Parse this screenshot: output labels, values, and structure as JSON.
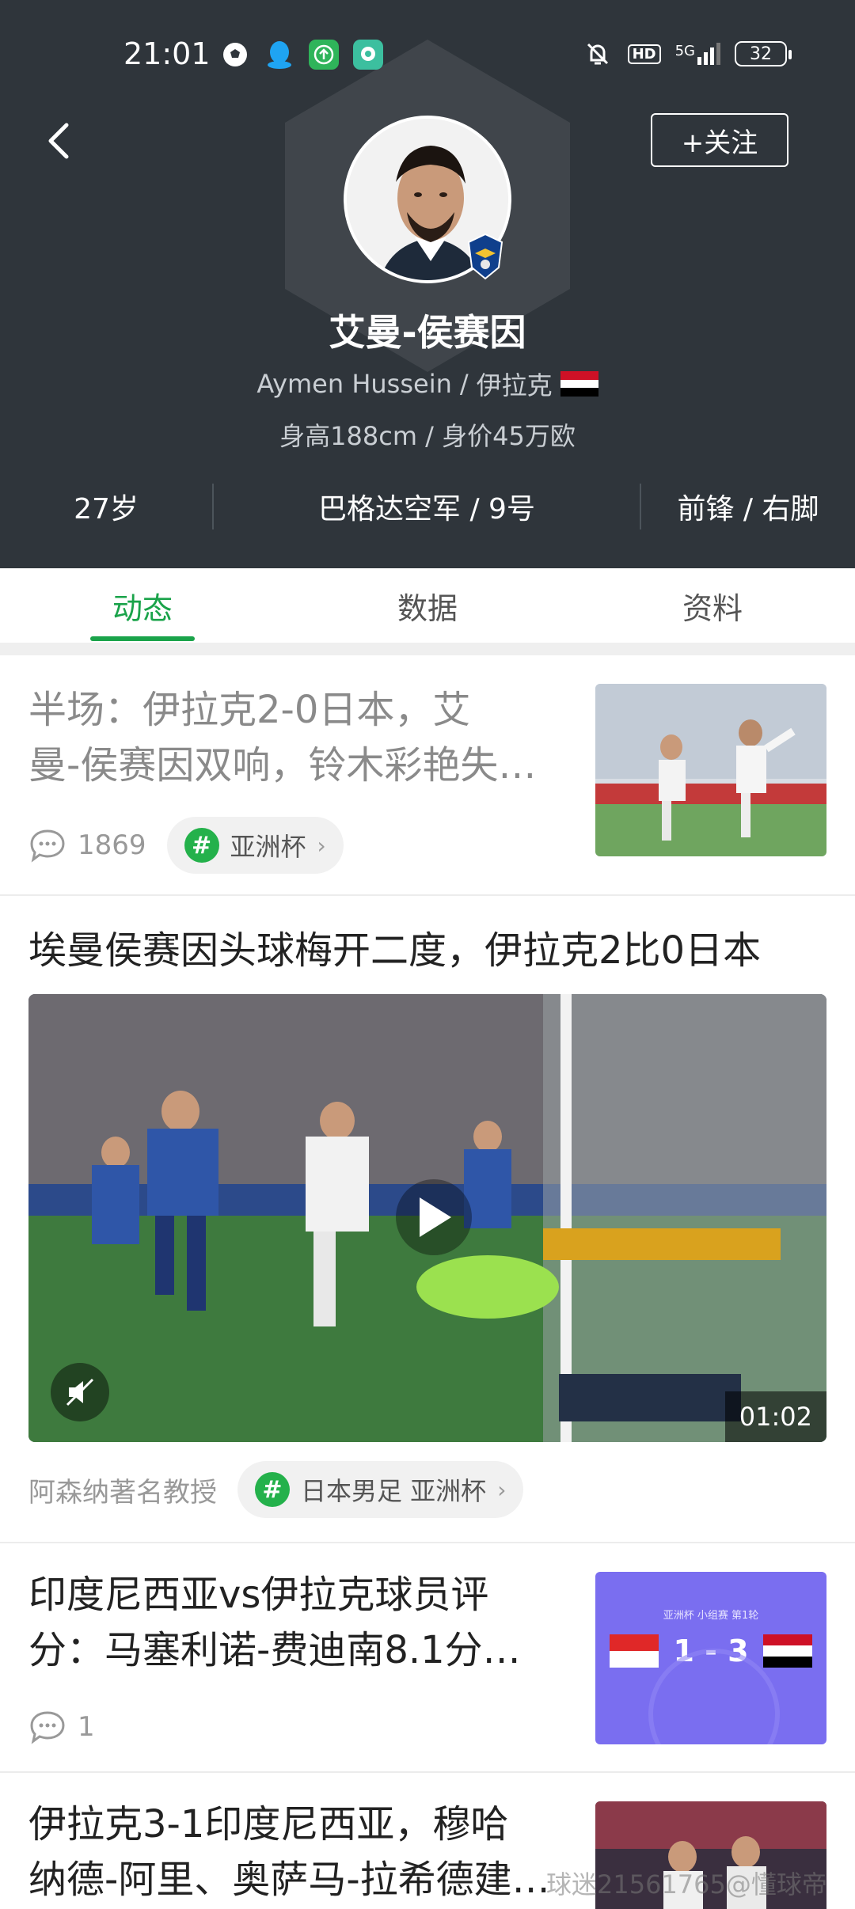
{
  "status_bar": {
    "time": "21:01",
    "network": "5G",
    "hd": "HD",
    "battery": "32"
  },
  "header": {
    "follow_label": "+关注",
    "player_name": "艾曼-侯赛因",
    "name_en": "Aymen Hussein",
    "nationality": "伊拉克",
    "separator": "/",
    "body_info": "身高188cm / 身价45万欧",
    "stats": {
      "age": "27岁",
      "club": "巴格达空军 / 9号",
      "position": "前锋 / 右脚"
    }
  },
  "tabs": [
    {
      "label": "动态",
      "active": true
    },
    {
      "label": "数据",
      "active": false
    },
    {
      "label": "资料",
      "active": false
    }
  ],
  "feed": {
    "article1": {
      "title": "半场：伊拉克2-0日本，艾曼-侯赛因双响，铃木彩艳失…",
      "title_line1": "半场：伊拉克2-0日本，艾",
      "title_line2": "曼-侯赛因双响，铃木彩艳失…",
      "comments": "1869",
      "tag": "亚洲杯"
    },
    "article2": {
      "title": "埃曼侯赛因头球梅开二度，伊拉克2比0日本",
      "author": "阿森纳著名教授",
      "tag": "日本男足 亚洲杯",
      "duration": "01:02"
    },
    "article3": {
      "title_line1": "印度尼西亚vs伊拉克球员评",
      "title_line2": "分：马塞利诺-费迪南8.1分…",
      "comments": "1",
      "thumb_caption": "亚洲杯 小组赛 第1轮",
      "thumb_score": "1 - 3"
    },
    "article4": {
      "title_line1": "伊拉克3-1印度尼西亚，穆哈",
      "title_line2": "纳德-阿里、奥萨马-拉希德建…"
    }
  },
  "watermark": "球迷21561765@懂球帝",
  "colors": {
    "header_bg": "#2f353b",
    "accent_green": "#1aa34a",
    "tag_bg": "#f1f1f1"
  }
}
